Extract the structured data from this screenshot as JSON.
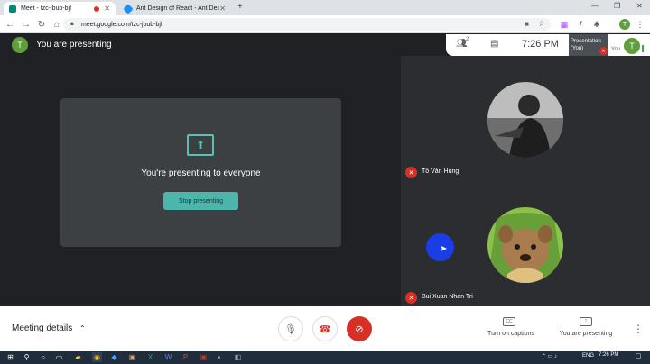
{
  "browser": {
    "tabs": [
      {
        "title": "Meet - tzc-jbub-bjf",
        "active": true
      },
      {
        "title": "Ant Design of React - Ant Design",
        "active": false
      }
    ],
    "new_tab": "+",
    "url": "meet.google.com/tzc-jbub-bjf",
    "profile_initial": "T"
  },
  "meet": {
    "presenter_initial": "T",
    "presenting_title": "You are presenting",
    "present_message": "You're presenting to everyone",
    "stop_button": "Stop presenting",
    "time": "7:26 PM",
    "participants_count": "2",
    "self_thumb": {
      "label": "Presentation (You)",
      "you": "You",
      "initial": "T"
    },
    "participants": [
      {
        "name": "Tô Văn Hùng",
        "muted": true
      },
      {
        "name": "Bui Xuan Nhan Tri",
        "muted": true
      }
    ]
  },
  "bottom": {
    "meeting_details": "Meeting details",
    "captions_label": "Turn on captions",
    "present_label": "You are presenting"
  },
  "taskbar": {
    "lang": "ENG",
    "time": "7:26 PM"
  },
  "colors": {
    "meet_bg": "#202124",
    "accent": "#4db6ac",
    "danger": "#d93025"
  }
}
